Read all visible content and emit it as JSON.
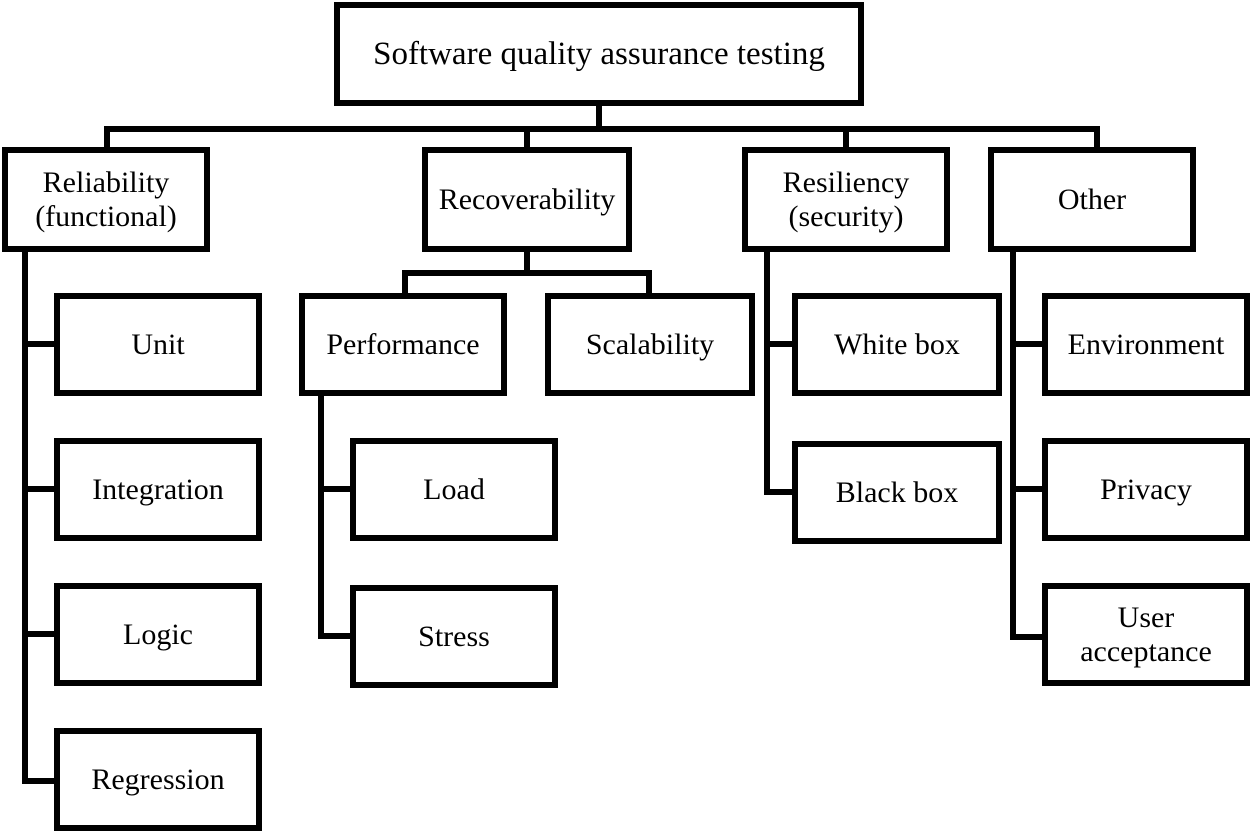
{
  "diagram": {
    "title": "Software quality assurance testing",
    "type": "tree-hierarchy",
    "orientation": "top-down-then-left-bus",
    "style": {
      "background": "#ffffff",
      "line_color": "#000000",
      "text_color": "#000000",
      "border_width_px": 6
    },
    "root": {
      "label": "Software quality assurance testing"
    },
    "level2": [
      {
        "label": "Reliability\n(functional)"
      },
      {
        "label": "Recoverability"
      },
      {
        "label": "Resiliency\n(security)"
      },
      {
        "label": "Other"
      }
    ],
    "reliability_children": [
      {
        "label": "Unit"
      },
      {
        "label": "Integration"
      },
      {
        "label": "Logic"
      },
      {
        "label": "Regression"
      }
    ],
    "recoverability_children": [
      {
        "label": "Performance"
      },
      {
        "label": "Scalability"
      }
    ],
    "performance_children": [
      {
        "label": "Load"
      },
      {
        "label": "Stress"
      }
    ],
    "resiliency_children": [
      {
        "label": "White box"
      },
      {
        "label": "Black box"
      }
    ],
    "other_children": [
      {
        "label": "Environment"
      },
      {
        "label": "Privacy"
      },
      {
        "label": "User\nacceptance"
      }
    ]
  }
}
